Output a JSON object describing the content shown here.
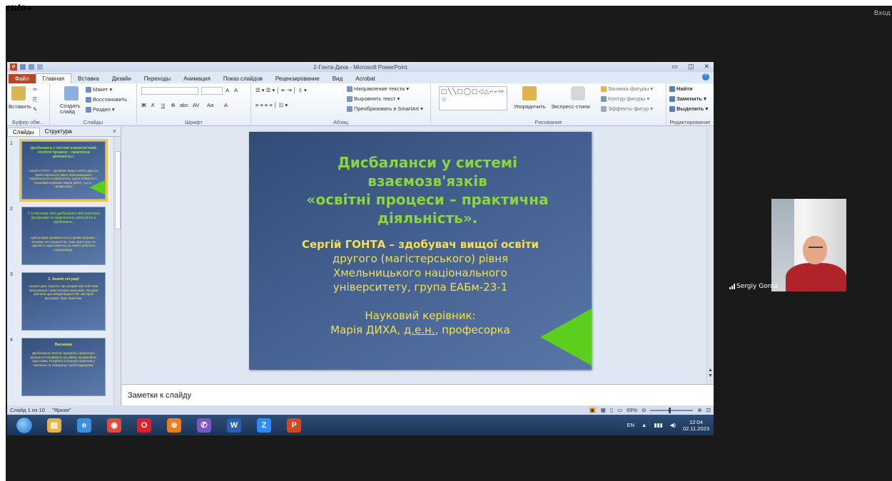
{
  "meeting": {
    "top_left_text": "ento»",
    "join_label": "Вход",
    "participant": {
      "name": "Sergiy Gonta"
    }
  },
  "powerpoint": {
    "window_title": "2-Гонта-Диха - Microsoft PowerPoint",
    "tabs": [
      "Файл",
      "Главная",
      "Вставка",
      "Дизайн",
      "Переходы",
      "Анимация",
      "Показ слайдов",
      "Рецензирование",
      "Вид",
      "Acrobat"
    ],
    "active_tab": "Главная",
    "ribbon": {
      "clipboard": {
        "paste": "Вставить",
        "group": "Буфер обм..."
      },
      "slides": {
        "layout": "Макет",
        "reset": "Восстановить",
        "create": "Создать слайд",
        "section": "Раздел",
        "group": "Слайды"
      },
      "font": {
        "group": "Шрифт",
        "bold": "Ж",
        "italic": "К",
        "underline": "Ч",
        "strike": "S",
        "shadow": "abc",
        "spacing": "AV",
        "case": "Aa",
        "color": "A",
        "grow": "A",
        "shrink": "A"
      },
      "paragraph": {
        "group": "Абзац",
        "text_direction": "Направление текста",
        "align_text": "Выровнять текст",
        "smartart": "Преобразовать в SmartArt"
      },
      "drawing": {
        "group": "Рисование",
        "arrange": "Упорядочить",
        "quick_styles": "Экспресс-стили",
        "fill": "Заливка фигуры",
        "outline": "Контур фигуры",
        "effects": "Эффекты фигур",
        "shapes_glyphs": "▢╲╲▢◯▢◁△⌐⌐⇨⇩◻⟡⌒◠{}☆"
      },
      "editing": {
        "group": "Редактирование",
        "find": "Найти",
        "replace": "Заменить",
        "select": "Выделить"
      }
    },
    "panel": {
      "tabs": [
        "Слайды",
        "Структура"
      ],
      "close": "×",
      "thumbnails": [
        {
          "number": "1",
          "title": "Дисбаланси у системі взаємозв'язків «освітні процеси – практична діяльність».",
          "body": "Сергій ГОНТА – здобувач вищої освіти другого (магістерського) рівня Хмельницького національного університету, група ЕАБм-23-1. Науковий керівник: Марія ДИХА, д.е.н., професорка"
        },
        {
          "number": "2",
          "title": "У сучасному світі дисбаланси між освітніми процесами та практичною діяльністю є проблемою.",
          "body": "Цей розрив проявляється у різних формах і впливає на спеціалістів, їхню підготовку та здатність адаптуватися до вимог робочого середовища."
        },
        {
          "number": "3",
          "title": "2. Аналіз ситуації",
          "body": "Існуючі дані свідчать про розрив між освітніми програмами і практичними вимогами. Основні причини цих невідповідностей: застарілі програми, брак практики."
        },
        {
          "number": "4",
          "title": "Висновки",
          "body": "Дисбаланси освітніх процесів і практичної діяльності впливають на рівень професійної підготовки. Потрібна інтеграція практики у навчання та співпраця з роботодавцями."
        }
      ]
    },
    "slide": {
      "title_lines": [
        "Дисбаланси у системі",
        "взаємозв'язків",
        "«освітні процеси – практична",
        "діяльність»."
      ],
      "author_lines": [
        "Сергій ГОНТА – здобувач вищої освіти",
        "другого (магістерського) рівня",
        "Хмельницького національного",
        "університету, група ЕАБм-23-1"
      ],
      "supervisor_label": "Науковий керівник:",
      "supervisor_name": "Марія ДИХА,",
      "supervisor_degree": "д.е.н.",
      "supervisor_title": ", професорка"
    },
    "notes_placeholder": "Заметки к слайду",
    "status": {
      "slide_counter": "Слайд 1 из 10",
      "theme": "\"Яркая\"",
      "zoom": "69%"
    }
  },
  "taskbar": {
    "apps": [
      {
        "name": "file-explorer-icon",
        "glyph": "▤",
        "color": "#e6b24a"
      },
      {
        "name": "internet-explorer-icon",
        "glyph": "e",
        "color": "#3b8fe0"
      },
      {
        "name": "chrome-icon",
        "glyph": "◉",
        "color": "#e14b3b"
      },
      {
        "name": "opera-icon",
        "glyph": "O",
        "color": "#d8222a"
      },
      {
        "name": "avast-icon",
        "glyph": "⊛",
        "color": "#f07d1a"
      },
      {
        "name": "viber-icon",
        "glyph": "✆",
        "color": "#7b56c4"
      },
      {
        "name": "word-icon",
        "glyph": "W",
        "color": "#2b5fb4"
      },
      {
        "name": "zoom-icon",
        "glyph": "Z",
        "color": "#2d8cff"
      },
      {
        "name": "powerpoint-icon",
        "glyph": "P",
        "color": "#d2481f"
      }
    ],
    "lang": "EN",
    "time": "12:04",
    "date": "02.11.2023"
  }
}
